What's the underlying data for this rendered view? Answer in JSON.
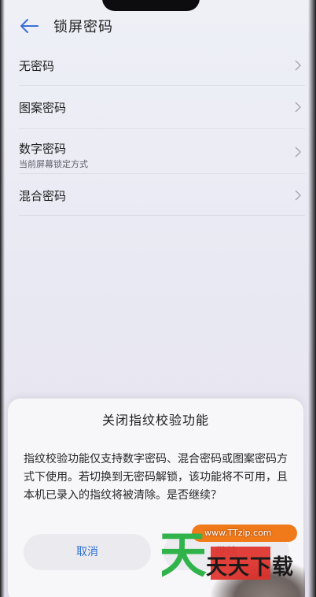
{
  "header": {
    "title": "锁屏密码"
  },
  "list": {
    "items": [
      {
        "label": "无密码",
        "sub": ""
      },
      {
        "label": "图案密码",
        "sub": ""
      },
      {
        "label": "数字密码",
        "sub": "当前屏幕锁定方式"
      },
      {
        "label": "混合密码",
        "sub": ""
      }
    ]
  },
  "dialog": {
    "title": "关闭指纹校验功能",
    "body": "指纹校验功能仅支持数字密码、混合密码或图案密码方式下使用。若切换到无密码解锁，该功能将不可用，且本机已录入的指纹将被清除。是否继续？",
    "cancel_label": "取消",
    "continue_label": "继续"
  },
  "watermark": {
    "url": "www.TTzip.com",
    "text": "天天下载",
    "logo_char": "天"
  },
  "colors": {
    "accent": "#2d6fd8",
    "watermark_green": "#2fb34a",
    "watermark_red": "#e0302a",
    "watermark_orange": "#f07a1a"
  },
  "icons": {
    "back": "arrow-left-icon",
    "chevron": "chevron-right-icon"
  }
}
